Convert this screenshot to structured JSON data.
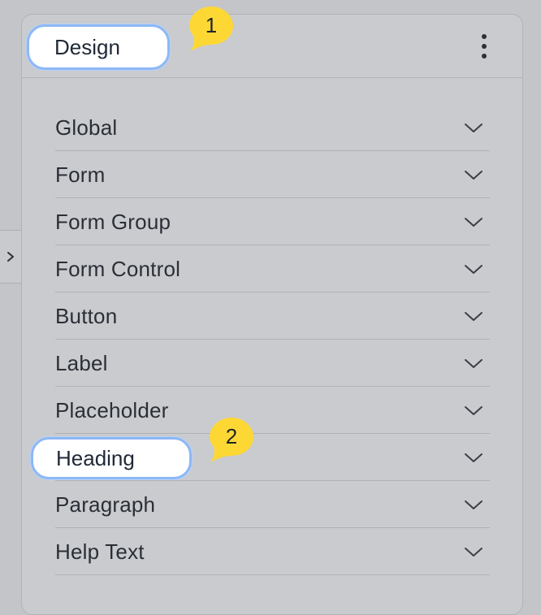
{
  "panel": {
    "title": "Design",
    "menu_icon": "kebab-menu-icon"
  },
  "sidebar_toggle": {
    "icon": "chevron-right-icon"
  },
  "sections": [
    {
      "label": "Global",
      "icon": "chevron-down-icon"
    },
    {
      "label": "Form",
      "icon": "chevron-down-icon"
    },
    {
      "label": "Form Group",
      "icon": "chevron-down-icon"
    },
    {
      "label": "Form Control",
      "icon": "chevron-down-icon"
    },
    {
      "label": "Button",
      "icon": "chevron-down-icon"
    },
    {
      "label": "Label",
      "icon": "chevron-down-icon"
    },
    {
      "label": "Placeholder",
      "icon": "chevron-down-icon"
    },
    {
      "label": "Heading",
      "icon": "chevron-down-icon"
    },
    {
      "label": "Paragraph",
      "icon": "chevron-down-icon"
    },
    {
      "label": "Help Text",
      "icon": "chevron-down-icon"
    }
  ],
  "annotations": {
    "step1": "1",
    "step2": "2"
  },
  "colors": {
    "highlight_border": "#8db8f5",
    "bubble_fill": "#fdd835",
    "text": "#2a2f37"
  }
}
